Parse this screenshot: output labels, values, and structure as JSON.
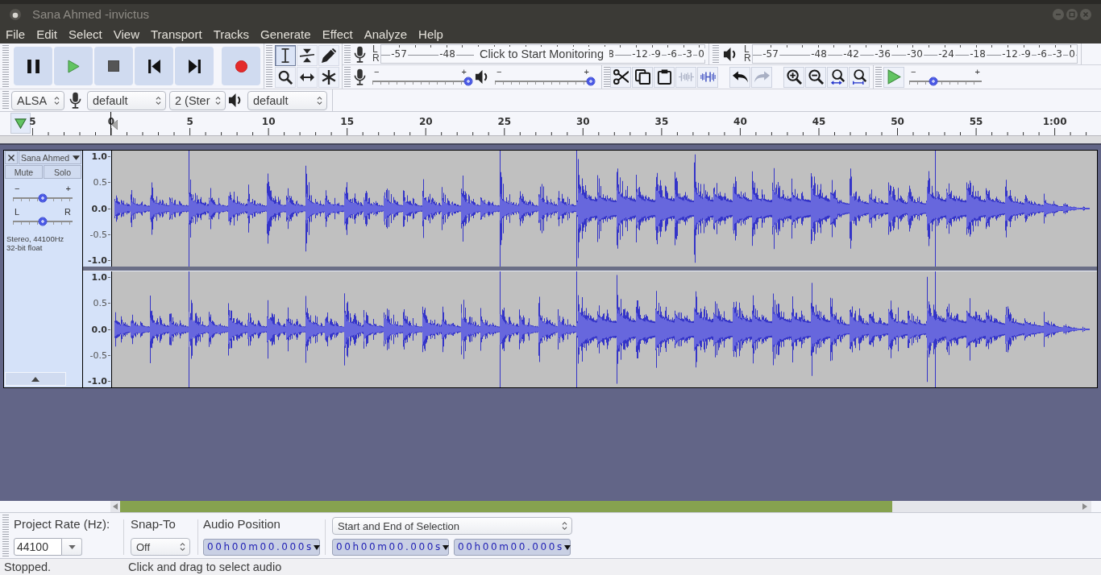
{
  "window": {
    "title": "Sana Ahmed -invictus"
  },
  "menu": [
    "File",
    "Edit",
    "Select",
    "View",
    "Transport",
    "Tracks",
    "Generate",
    "Effect",
    "Analyze",
    "Help"
  ],
  "tools": [
    {
      "kind": "select",
      "selected": true
    },
    {
      "kind": "envelope",
      "selected": false
    },
    {
      "kind": "draw",
      "selected": false
    },
    {
      "kind": "zoom",
      "selected": false
    },
    {
      "kind": "time-shift",
      "selected": false
    },
    {
      "kind": "multi",
      "selected": false
    }
  ],
  "recording_meter": {
    "channels": [
      "L",
      "R"
    ],
    "ticks": [
      "-57",
      "-48",
      "8",
      "-12",
      "-9",
      "-6",
      "-3",
      "0"
    ],
    "prompt": "Click to Start Monitoring"
  },
  "playback_meter": {
    "channels": [
      "L",
      "R"
    ],
    "ticks": [
      "-57",
      "-48",
      "-42",
      "-36",
      "-30",
      "-24",
      "-18",
      "-12",
      "-9",
      "-6",
      "-3",
      "0"
    ]
  },
  "mixer": {
    "recording_volume": {
      "minus": "−",
      "plus": "+",
      "level": 1
    },
    "playback_volume": {
      "minus": "−",
      "plus": "+",
      "level": 1
    }
  },
  "edit_buttons": [
    {
      "kind": "cut",
      "disabled": false
    },
    {
      "kind": "copy",
      "disabled": false
    },
    {
      "kind": "paste",
      "disabled": false
    },
    {
      "kind": "trim",
      "disabled": true
    },
    {
      "kind": "silence",
      "disabled": false
    }
  ],
  "history_buttons": [
    {
      "kind": "undo",
      "disabled": false
    },
    {
      "kind": "redo",
      "disabled": true
    }
  ],
  "play_at_speed": {
    "minus": "−",
    "plus": "+",
    "level": 0.33
  },
  "devices": {
    "host": "ALSA",
    "recording_device": "default",
    "recording_channels": "2 (Ster",
    "playback_device": "default"
  },
  "timeline": {
    "labels": [
      "5",
      "0",
      "5",
      "10",
      "15",
      "20",
      "25",
      "30",
      "35",
      "40",
      "45",
      "50",
      "55",
      "1:00"
    ]
  },
  "track": {
    "name": "Sana Ahmed",
    "mute": "Mute",
    "solo": "Solo",
    "gain": {
      "minus": "−",
      "plus": "+",
      "level": 0.5
    },
    "pan": {
      "left": "L",
      "right": "R",
      "level": 0.5
    },
    "info": [
      "Stereo, 44100Hz",
      "32-bit float"
    ],
    "channels": [
      {
        "scale": [
          "1.0",
          "0.5",
          "0.0",
          "-0.5",
          "-1.0"
        ]
      },
      {
        "scale": [
          "1.0",
          "0.5",
          "0.0",
          "-0.5",
          "-1.0"
        ]
      }
    ]
  },
  "selection_toolbar": {
    "project_rate": {
      "label": "Project Rate (Hz):",
      "value": "44100"
    },
    "snap_to": {
      "label": "Snap-To",
      "value": "Off"
    },
    "audio_position": {
      "label": "Audio Position",
      "time": "00h00m00.000s"
    },
    "selection": {
      "mode": "Start and End of Selection",
      "start": "00h00m00.000s",
      "end": "00h00m00.000s"
    }
  },
  "status_bar": {
    "state": "Stopped.",
    "hint": "Click and drag to select audio"
  }
}
